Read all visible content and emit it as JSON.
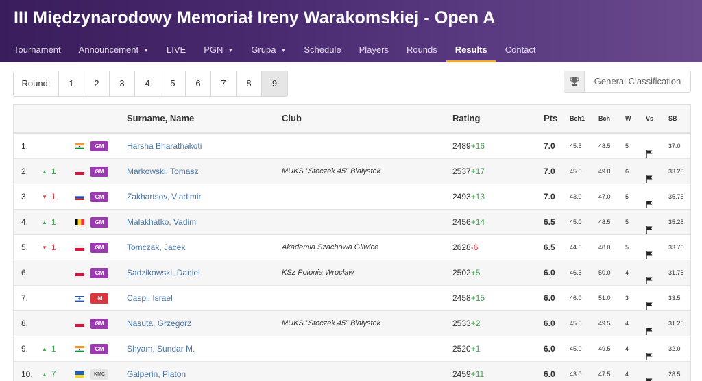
{
  "header": {
    "title": "III Międzynarodowy Memoriał Ireny Warakomskiej - Open A"
  },
  "nav": {
    "items": [
      {
        "label": "Tournament",
        "dropdown": false,
        "active": false
      },
      {
        "label": "Announcement",
        "dropdown": true,
        "active": false
      },
      {
        "label": "LIVE",
        "dropdown": false,
        "active": false
      },
      {
        "label": "PGN",
        "dropdown": true,
        "active": false
      },
      {
        "label": "Grupa",
        "dropdown": true,
        "active": false
      },
      {
        "label": "Schedule",
        "dropdown": false,
        "active": false
      },
      {
        "label": "Players",
        "dropdown": false,
        "active": false
      },
      {
        "label": "Rounds",
        "dropdown": false,
        "active": false
      },
      {
        "label": "Results",
        "dropdown": false,
        "active": true
      },
      {
        "label": "Contact",
        "dropdown": false,
        "active": false
      }
    ]
  },
  "rounds": {
    "label": "Round:",
    "items": [
      "1",
      "2",
      "3",
      "4",
      "5",
      "6",
      "7",
      "8",
      "9"
    ],
    "active": "9"
  },
  "general_classification": {
    "label": "General Classification",
    "icon": "trophy-icon"
  },
  "table": {
    "headers": {
      "name": "Surname, Name",
      "club": "Club",
      "rating": "Rating",
      "pts": "Pts",
      "bch1": "Bch1",
      "bch": "Bch",
      "w": "W",
      "vs": "Vs",
      "sb": "SB"
    },
    "rows": [
      {
        "no": "1.",
        "move": null,
        "move_dir": null,
        "flag": "IND",
        "title": "GM",
        "name": "Harsha Bharathakoti",
        "club": "",
        "rating": "2489",
        "change": "+16",
        "pts": "7.0",
        "bch1": "45.5",
        "bch": "48.5",
        "w": "5",
        "vs": "flag-icon",
        "sb": "37.0"
      },
      {
        "no": "2.",
        "move": "1",
        "move_dir": "up",
        "flag": "POL",
        "title": "GM",
        "name": "Markowski, Tomasz",
        "club": "MUKS \"Stoczek 45\" Białystok",
        "rating": "2537",
        "change": "+17",
        "pts": "7.0",
        "bch1": "45.0",
        "bch": "49.0",
        "w": "6",
        "vs": "flag-icon",
        "sb": "33.25"
      },
      {
        "no": "3.",
        "move": "1",
        "move_dir": "down",
        "flag": "RUS",
        "title": "GM",
        "name": "Zakhartsov, Vladimir",
        "club": "",
        "rating": "2493",
        "change": "+13",
        "pts": "7.0",
        "bch1": "43.0",
        "bch": "47.0",
        "w": "5",
        "vs": "flag-icon",
        "sb": "35.75"
      },
      {
        "no": "4.",
        "move": "1",
        "move_dir": "up",
        "flag": "BEL",
        "title": "GM",
        "name": "Malakhatko, Vadim",
        "club": "",
        "rating": "2456",
        "change": "+14",
        "pts": "6.5",
        "bch1": "45.0",
        "bch": "48.5",
        "w": "5",
        "vs": "flag-icon",
        "sb": "35.25"
      },
      {
        "no": "5.",
        "move": "1",
        "move_dir": "down",
        "flag": "POL",
        "title": "GM",
        "name": "Tomczak, Jacek",
        "club": "Akademia Szachowa Gliwice",
        "rating": "2628",
        "change": "-6",
        "pts": "6.5",
        "bch1": "44.0",
        "bch": "48.0",
        "w": "5",
        "vs": "flag-icon",
        "sb": "33.75"
      },
      {
        "no": "6.",
        "move": null,
        "move_dir": null,
        "flag": "POL",
        "title": "GM",
        "name": "Sadzikowski, Daniel",
        "club": "KSz Polonia Wrocław",
        "rating": "2502",
        "change": "+5",
        "pts": "6.0",
        "bch1": "46.5",
        "bch": "50.0",
        "w": "4",
        "vs": "flag-icon",
        "sb": "31.75"
      },
      {
        "no": "7.",
        "move": null,
        "move_dir": null,
        "flag": "ISR",
        "title": "IM",
        "name": "Caspi, Israel",
        "club": "",
        "rating": "2458",
        "change": "+15",
        "pts": "6.0",
        "bch1": "46.0",
        "bch": "51.0",
        "w": "3",
        "vs": "flag-icon",
        "sb": "33.5"
      },
      {
        "no": "8.",
        "move": null,
        "move_dir": null,
        "flag": "POL",
        "title": "GM",
        "name": "Nasuta, Grzegorz",
        "club": "MUKS \"Stoczek 45\" Białystok",
        "rating": "2533",
        "change": "+2",
        "pts": "6.0",
        "bch1": "45.5",
        "bch": "49.5",
        "w": "4",
        "vs": "flag-icon",
        "sb": "31.25"
      },
      {
        "no": "9.",
        "move": "1",
        "move_dir": "up",
        "flag": "IND",
        "title": "GM",
        "name": "Shyam, Sundar M.",
        "club": "",
        "rating": "2520",
        "change": "+1",
        "pts": "6.0",
        "bch1": "45.0",
        "bch": "49.5",
        "w": "4",
        "vs": "flag-icon",
        "sb": "32.0"
      },
      {
        "no": "10.",
        "move": "7",
        "move_dir": "up",
        "flag": "UKR",
        "title": "KMC",
        "name": "Galperin, Platon",
        "club": "",
        "rating": "2459",
        "change": "+11",
        "pts": "6.0",
        "bch1": "43.0",
        "bch": "47.5",
        "w": "4",
        "vs": "flag-icon",
        "sb": "28.5"
      }
    ]
  },
  "colors": {
    "header_bg": "#4a2a70",
    "active_underline": "#f0a830",
    "link": "#4a76a8",
    "positive": "#3aa64a",
    "negative": "#d9363e",
    "gm_badge": "#9b3bb0",
    "im_badge": "#d9363e"
  }
}
